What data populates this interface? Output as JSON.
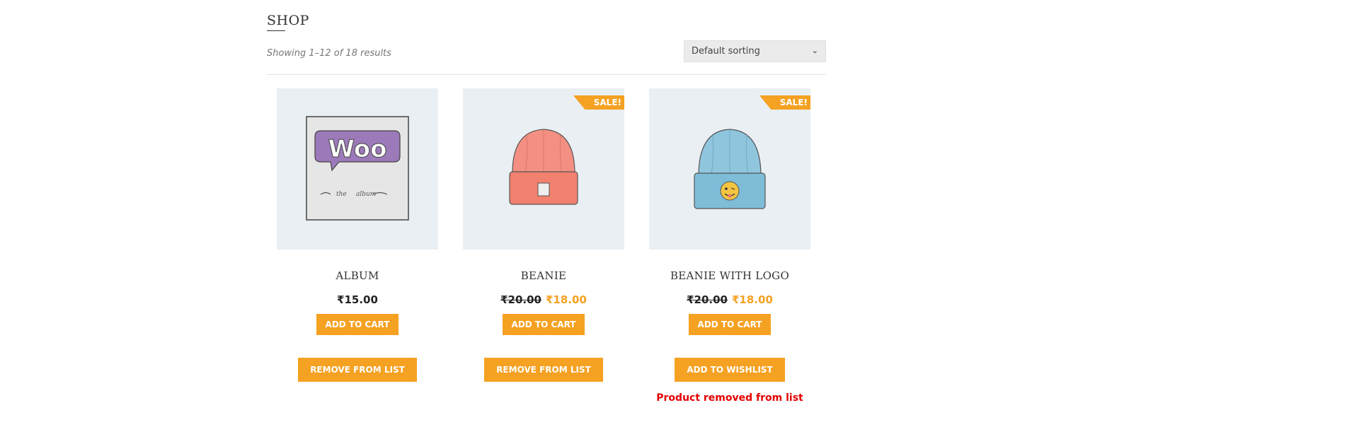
{
  "page": {
    "title": "SHOP"
  },
  "toolbar": {
    "result_count": "Showing 1–12 of 18 results",
    "sort_selected": "Default sorting"
  },
  "products": [
    {
      "name": "ALBUM",
      "price": "₹15.00",
      "cart_label": "ADD TO CART",
      "wishlist_label": "REMOVE FROM LIST",
      "image_icon": "woo-album-icon"
    },
    {
      "name": "BEANIE",
      "badge": "SALE!",
      "regular_price": "₹20.00",
      "sale_price": "₹18.00",
      "cart_label": "ADD TO CART",
      "wishlist_label": "REMOVE FROM LIST",
      "image_icon": "pink-beanie-icon"
    },
    {
      "name": "BEANIE WITH LOGO",
      "badge": "SALE!",
      "regular_price": "₹20.00",
      "sale_price": "₹18.00",
      "cart_label": "ADD TO CART",
      "wishlist_label": "ADD TO WISHLIST",
      "notice": "Product removed from list",
      "image_icon": "blue-beanie-logo-icon"
    }
  ],
  "colors": {
    "accent": "#f5a122",
    "notice": "#e40000",
    "thumb_bg": "#e9eff2"
  }
}
